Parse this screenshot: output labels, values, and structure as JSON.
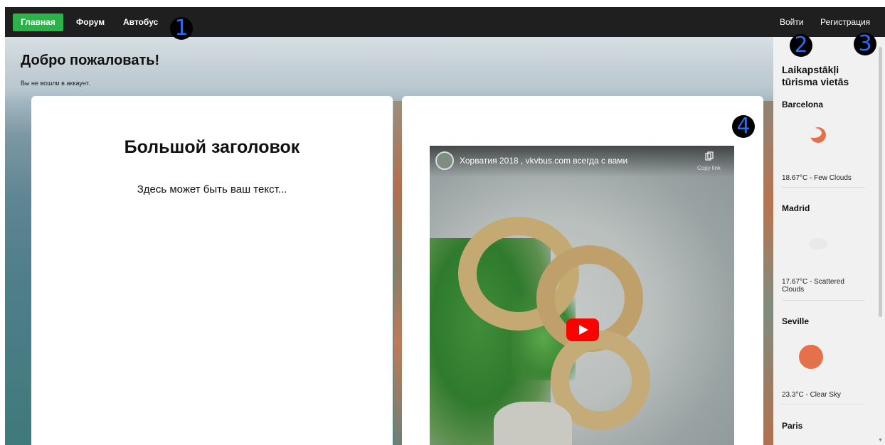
{
  "navbar": {
    "home": "Главная",
    "forum": "Форум",
    "bus": "Автобус",
    "login": "Войти",
    "register": "Регистрация"
  },
  "markers": [
    "1",
    "2",
    "3",
    "4"
  ],
  "welcome": {
    "title": "Добро пожаловать!",
    "subtitle": "Вы не вошли в аккаунт."
  },
  "card": {
    "heading": "Большой заголовок",
    "text": "Здесь может быть ваш текст..."
  },
  "video": {
    "title": "Хорватия 2018 , vkvbus.com всегда с вами",
    "copy_label": "Copy link"
  },
  "weather": {
    "title": "Laikapstākļi tūrisma vietās",
    "cities": [
      {
        "name": "Barcelona",
        "info": "18.67°C - Few Clouds",
        "icon": "few-clouds-icon"
      },
      {
        "name": "Madrid",
        "info": "17.67°C - Scattered Clouds",
        "icon": "scattered-clouds-icon"
      },
      {
        "name": "Seville",
        "info": "23.3°C - Clear Sky",
        "icon": "clear-sky-icon"
      },
      {
        "name": "Paris",
        "info": "",
        "icon": ""
      }
    ]
  },
  "colors": {
    "navbar_bg": "#1f1f1f",
    "home_active": "#2bb34a",
    "marker_text": "#2a6cf0",
    "sun": "#e5714a",
    "youtube_red": "#ff0000"
  }
}
